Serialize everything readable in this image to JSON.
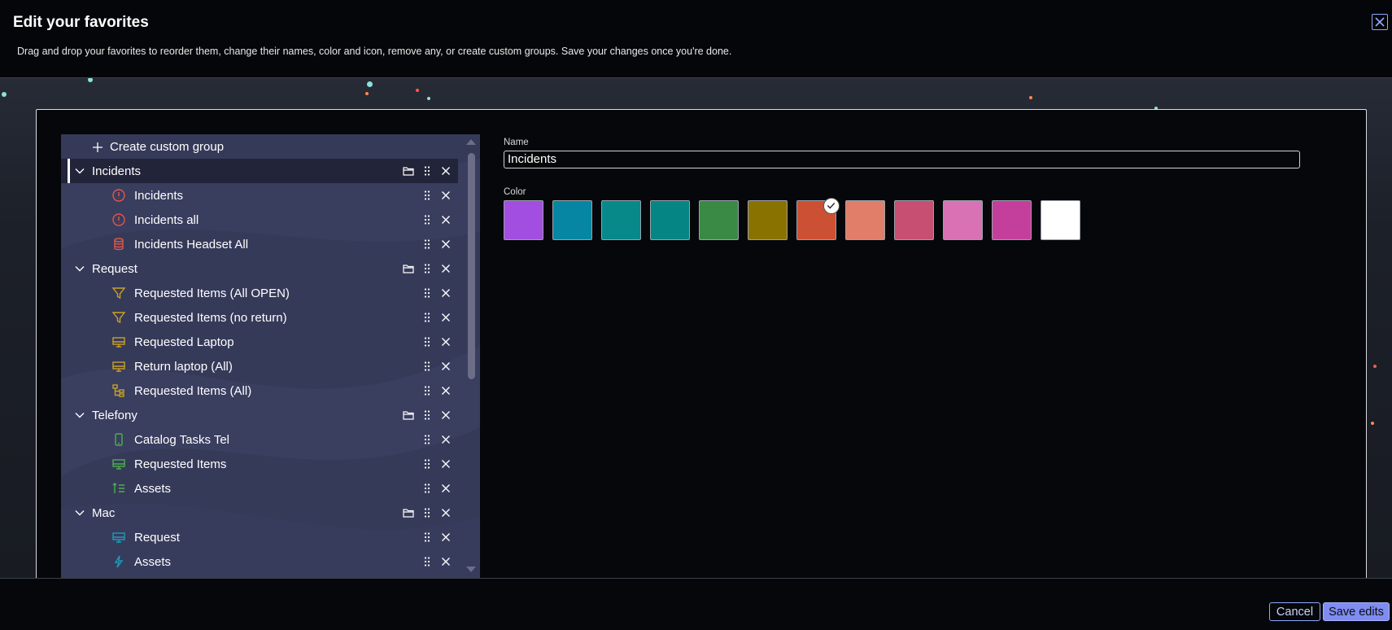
{
  "dialog": {
    "title": "Edit your favorites",
    "subtitle": "Drag and drop your favorites to reorder them, change their names, color and icon, remove any, or create custom groups. Save your changes once you're done."
  },
  "create_group_label": "Create custom group",
  "groups": [
    {
      "label": "Incidents",
      "active": true,
      "items": [
        {
          "label": "Incidents",
          "icon": "alert-circle-icon",
          "color": "#e0574a"
        },
        {
          "label": "Incidents all",
          "icon": "alert-circle-icon",
          "color": "#e0574a"
        },
        {
          "label": "Incidents Headset All",
          "icon": "database-icon",
          "color": "#e0574a"
        }
      ]
    },
    {
      "label": "Request",
      "active": false,
      "items": [
        {
          "label": "Requested Items (All OPEN)",
          "icon": "filter-icon",
          "color": "#c9a227"
        },
        {
          "label": "Requested Items (no return)",
          "icon": "filter-icon",
          "color": "#c9a227"
        },
        {
          "label": "Requested Laptop",
          "icon": "monitor-icon",
          "color": "#c9a227"
        },
        {
          "label": "Return laptop (All)",
          "icon": "monitor-icon",
          "color": "#c9a227"
        },
        {
          "label": "Requested Items (All)",
          "icon": "hierarchy-icon",
          "color": "#c9a227"
        }
      ]
    },
    {
      "label": "Telefony",
      "active": false,
      "items": [
        {
          "label": "Catalog Tasks Tel",
          "icon": "mobile-icon",
          "color": "#4caf50"
        },
        {
          "label": "Requested Items",
          "icon": "monitor-icon",
          "color": "#4caf50"
        },
        {
          "label": "Assets",
          "icon": "sort-list-icon",
          "color": "#4caf50"
        }
      ]
    },
    {
      "label": "Mac",
      "active": false,
      "items": [
        {
          "label": "Request",
          "icon": "monitor-icon",
          "color": "#1e9bb8"
        },
        {
          "label": "Assets",
          "icon": "lightning-icon",
          "color": "#1e9bb8"
        }
      ]
    }
  ],
  "editor": {
    "name_label": "Name",
    "name_value": "Incidents",
    "color_label": "Color",
    "colors": [
      "#a24ee0",
      "#0686a3",
      "#07898a",
      "#068585",
      "#3a8a46",
      "#8a7200",
      "#cc5033",
      "#e07e6a",
      "#c64f72",
      "#d872b4",
      "#c43f9c",
      "#ffffff"
    ],
    "selected_color_index": 6
  },
  "footer": {
    "cancel_label": "Cancel",
    "save_label": "Save edits"
  }
}
